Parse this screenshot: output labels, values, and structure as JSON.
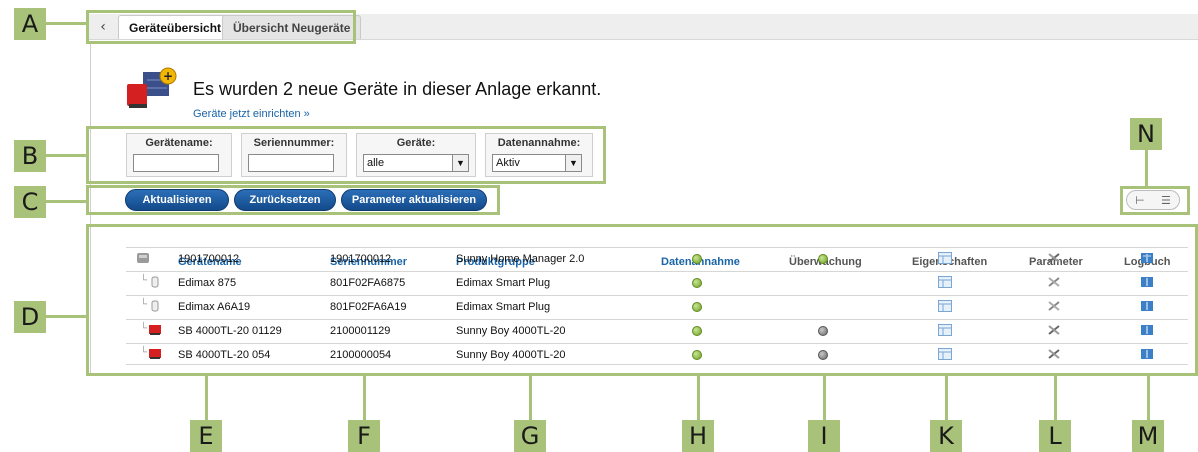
{
  "markers": [
    "A",
    "B",
    "C",
    "D",
    "E",
    "F",
    "G",
    "H",
    "I",
    "K",
    "L",
    "M",
    "N"
  ],
  "tabs": {
    "back_symbol": "‹",
    "items": [
      {
        "label": "Geräteübersicht",
        "active": true
      },
      {
        "label": "Übersicht Neugeräte",
        "active": false
      }
    ]
  },
  "notice": {
    "title": "Es wurden 2 neue Geräte in dieser Anlage erkannt.",
    "link": "Geräte jetzt einrichten »",
    "icon": "new-device-icon"
  },
  "filters": {
    "device_name_label": "Gerätename:",
    "device_name_value": "",
    "serial_label": "Seriennummer:",
    "serial_value": "",
    "devices_label": "Geräte:",
    "devices_value": "alle",
    "data_label": "Datenannahme:",
    "data_value": "Aktiv"
  },
  "buttons": {
    "refresh": "Aktualisieren",
    "reset": "Zurücksetzen",
    "update_params": "Parameter aktualisieren"
  },
  "view_toggle": {
    "tree_icon": "tree-view-icon",
    "list_icon": "list-view-icon",
    "active": "tree"
  },
  "table": {
    "headers": {
      "name": "Gerätename",
      "serial": "Seriennummer",
      "group": "Produktgruppe",
      "data": "Datenannahme",
      "monitor": "Überwachung",
      "props": "Eigenschaften",
      "params": "Parameter",
      "log": "Logbuch"
    },
    "rows": [
      {
        "name": "1901700012",
        "serial": "1901700012",
        "group": "Sunny Home Manager 2.0",
        "data": "green",
        "monitor": "green",
        "icon": "home-manager-icon"
      },
      {
        "name": "Edimax 875",
        "serial": "801F02FA6875",
        "group": "Edimax Smart Plug",
        "data": "green",
        "monitor": "",
        "icon": "smart-plug-icon"
      },
      {
        "name": "Edimax A6A19",
        "serial": "801F02FA6A19",
        "group": "Edimax Smart Plug",
        "data": "green",
        "monitor": "",
        "icon": "smart-plug-icon"
      },
      {
        "name": "SB 4000TL-20 01129",
        "serial": "2100001129",
        "group": "Sunny Boy 4000TL-20",
        "data": "green",
        "monitor": "grey",
        "icon": "inverter-icon"
      },
      {
        "name": "SB 4000TL-20 054",
        "serial": "2100000054",
        "group": "Sunny Boy 4000TL-20",
        "data": "green",
        "monitor": "grey",
        "icon": "inverter-icon"
      }
    ]
  },
  "colors": {
    "accent": "#a8c27a",
    "link": "#1a64a8",
    "button": "#1f5fa3",
    "status_ok": "#7ab83a",
    "status_off": "#888888"
  }
}
